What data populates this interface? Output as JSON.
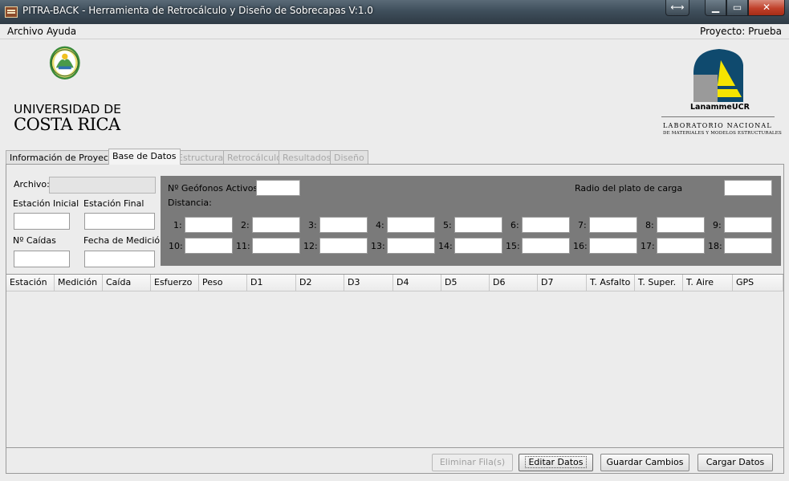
{
  "window": {
    "title": "PITRA-BACK - Herramienta de Retrocálculo y Diseño de Sobrecapas V:1.0",
    "resize_glyph": "⟷",
    "min_glyph": "▁",
    "max_glyph": "▭",
    "close_glyph": "✕"
  },
  "menu": {
    "items": [
      "Archivo",
      "Ayuda"
    ],
    "project": "Proyecto: Prueba"
  },
  "logos": {
    "ucr_line1": "UNIVERSIDAD DE",
    "ucr_line2": "COSTA RICA",
    "lanamme_name": "LanammeUCR",
    "lanamme_lab": "LABORATORIO NACIONAL",
    "lanamme_sub": "DE MATERIALES Y MODELOS ESTRUCTURALES"
  },
  "tabs": [
    {
      "label": "Información de Proyecto",
      "state": "normal"
    },
    {
      "label": "Base de Datos",
      "state": "active"
    },
    {
      "label": "Estructura",
      "state": "disabled"
    },
    {
      "label": "Retrocálculo",
      "state": "disabled"
    },
    {
      "label": "Resultados",
      "state": "disabled"
    },
    {
      "label": "Diseño",
      "state": "disabled"
    }
  ],
  "form": {
    "archivo_label": "Archivo:",
    "archivo_value": "",
    "estacion_inicial_label": "Estación Inicial",
    "estacion_final_label": "Estación Final",
    "n_caidas_label": "Nº Caídas",
    "fecha_label": "Fecha de Medición",
    "geofonos_label": "Nº Geófonos Activos",
    "radio_label": "Radio del plato de carga",
    "distancia_label": "Distancia:",
    "distances_row1": [
      "1:",
      "2:",
      "3:",
      "4:",
      "5:",
      "6:",
      "7:",
      "8:",
      "9:"
    ],
    "distances_row2": [
      "10:",
      "11:",
      "12:",
      "13:",
      "14:",
      "15:",
      "16:",
      "17:",
      "18:"
    ]
  },
  "table": {
    "columns": [
      "Estación",
      "Medición",
      "Caída",
      "Esfuerzo",
      "Peso",
      "D1",
      "D2",
      "D3",
      "D4",
      "D5",
      "D6",
      "D7",
      "T. Asfalto",
      "T. Super.",
      "T. Aire",
      "GPS"
    ],
    "rows": []
  },
  "buttons": {
    "eliminar": "Eliminar Fila(s)",
    "editar": "Editar Datos",
    "guardar": "Guardar Cambios",
    "cargar": "Cargar Datos"
  },
  "colors": {
    "lanamme_blue": "#0f4a6e",
    "lanamme_yellow": "#f5e400",
    "lanamme_gray": "#9a9a9a",
    "ucr_green": "#3a8a3a",
    "panel_gray": "#7a7a7a"
  }
}
